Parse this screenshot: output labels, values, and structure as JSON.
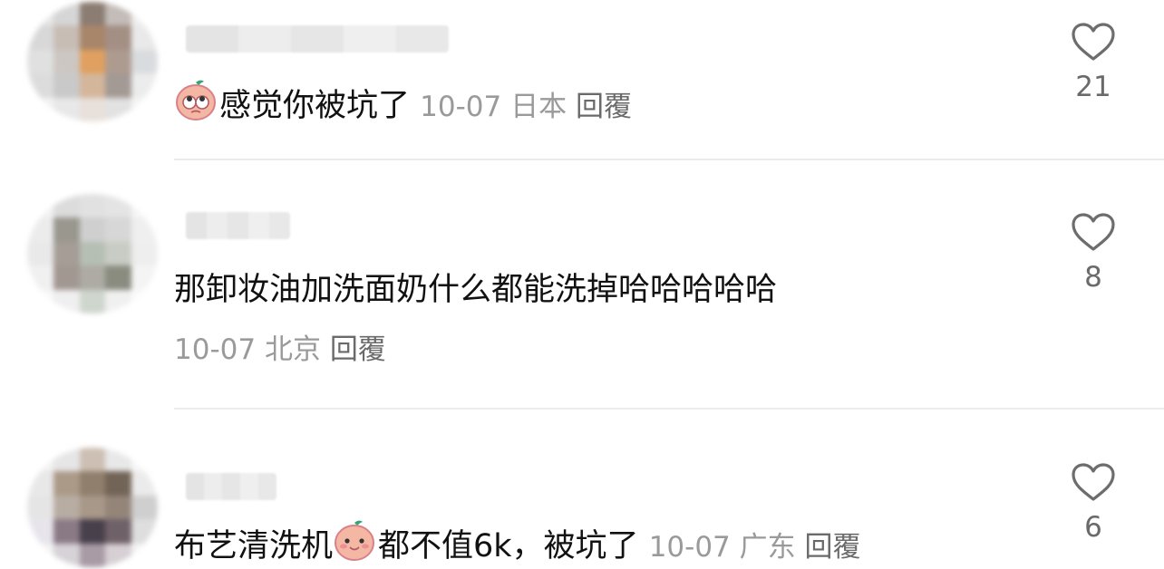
{
  "comments": [
    {
      "text": "感觉你被坑了",
      "date": "10-07",
      "location": "日本",
      "reply": "回覆",
      "likes": "21",
      "emoji": "peach-face-rolling-eyes",
      "avatar_colors": [
        "#e6e6e6",
        "#d6d6d6",
        "#8c7d72",
        "#c4bcb8",
        "#eeeeee",
        "#d8d8d8",
        "#c7bdb5",
        "#a8866a",
        "#a38f84",
        "#e9e9e9",
        "#e0e0e0",
        "#cdc7c3",
        "#e0a05f",
        "#ae9b90",
        "#d9dcdf",
        "#dcdcdc",
        "#c9c9c9",
        "#d4b69b",
        "#a39a95",
        "#ececec",
        "#f2f2f2",
        "#e8e8e8",
        "#e8e0da",
        "#e2e2e2",
        "#f4f4f4"
      ]
    },
    {
      "text": "那卸妆油加洗面奶什么都能洗掉哈哈哈哈哈",
      "date": "10-07",
      "location": "北京",
      "reply": "回覆",
      "likes": "8",
      "avatar_colors": [
        "#f2f2f2",
        "#dcdcdc",
        "#e1e1e1",
        "#e4e4e4",
        "#f5f5f5",
        "#ececec",
        "#9a978f",
        "#cfcfcf",
        "#d7d7d7",
        "#efefef",
        "#e9e9e9",
        "#a59d96",
        "#b5bfb3",
        "#c8ccc4",
        "#eeeeee",
        "#f0f0f0",
        "#a29892",
        "#adaba4",
        "#8a8c80",
        "#f4f4f4",
        "#f8f8f8",
        "#efefef",
        "#cfd6ce",
        "#f0f0f0",
        "#fafafa"
      ]
    },
    {
      "text_before": "布艺清洗机",
      "text_after": "都不值6k，被坑了",
      "date": "10-07",
      "location": "广东",
      "reply": "回覆",
      "likes": "6",
      "emoji": "peach-face-smiling",
      "avatar_colors": [
        "#f2f2f2",
        "#e6e6e6",
        "#cdbfb3",
        "#e8e8e8",
        "#f7f7f7",
        "#e8e8e8",
        "#ab9a88",
        "#8f7f6c",
        "#726456",
        "#ebebeb",
        "#e5e5e5",
        "#b8ada3",
        "#a89889",
        "#948579",
        "#cfcfcf",
        "#e8e4ec",
        "#8a7a86",
        "#48404b",
        "#6f6168",
        "#dedede",
        "#f2f2f2",
        "#d7d2d8",
        "#a99ba5",
        "#d6cfd3",
        "#f4f4f4"
      ]
    }
  ],
  "colors": {
    "text": "#111111",
    "meta": "#9a9a9a",
    "reply": "#6a6a6a",
    "divider": "#ececec"
  }
}
